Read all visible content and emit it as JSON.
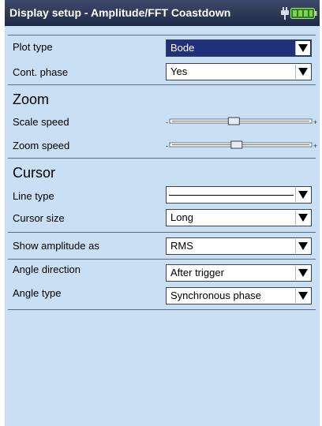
{
  "window": {
    "title": "Display setup - Amplitude/FFT Coastdown"
  },
  "status_icons": {
    "power": "plug-icon",
    "battery": "battery-icon"
  },
  "colors": {
    "panel_background": "#c9dff3",
    "title_bar": "#2a3452",
    "selected_dropdown": "#20307a"
  },
  "plot": {
    "plot_type_label": "Plot type",
    "plot_type_value": "Bode",
    "cont_phase_label": "Cont. phase",
    "cont_phase_value": "Yes"
  },
  "zoom": {
    "heading": "Zoom",
    "scale_speed_label": "Scale speed",
    "scale_speed_level": 0.45,
    "zoom_speed_label": "Zoom speed",
    "zoom_speed_level": 0.47,
    "slider_minus": "-",
    "slider_plus": "+"
  },
  "cursor": {
    "heading": "Cursor",
    "line_type_label": "Line type",
    "line_type_value": "solid line",
    "cursor_size_label": "Cursor size",
    "cursor_size_value": "Long"
  },
  "amplitude": {
    "show_amplitude_label": "Show amplitude as",
    "show_amplitude_value": "RMS"
  },
  "angle": {
    "direction_label": "Angle direction",
    "direction_value": "After trigger",
    "type_label": "Angle type",
    "type_value": "Synchronous phase"
  }
}
